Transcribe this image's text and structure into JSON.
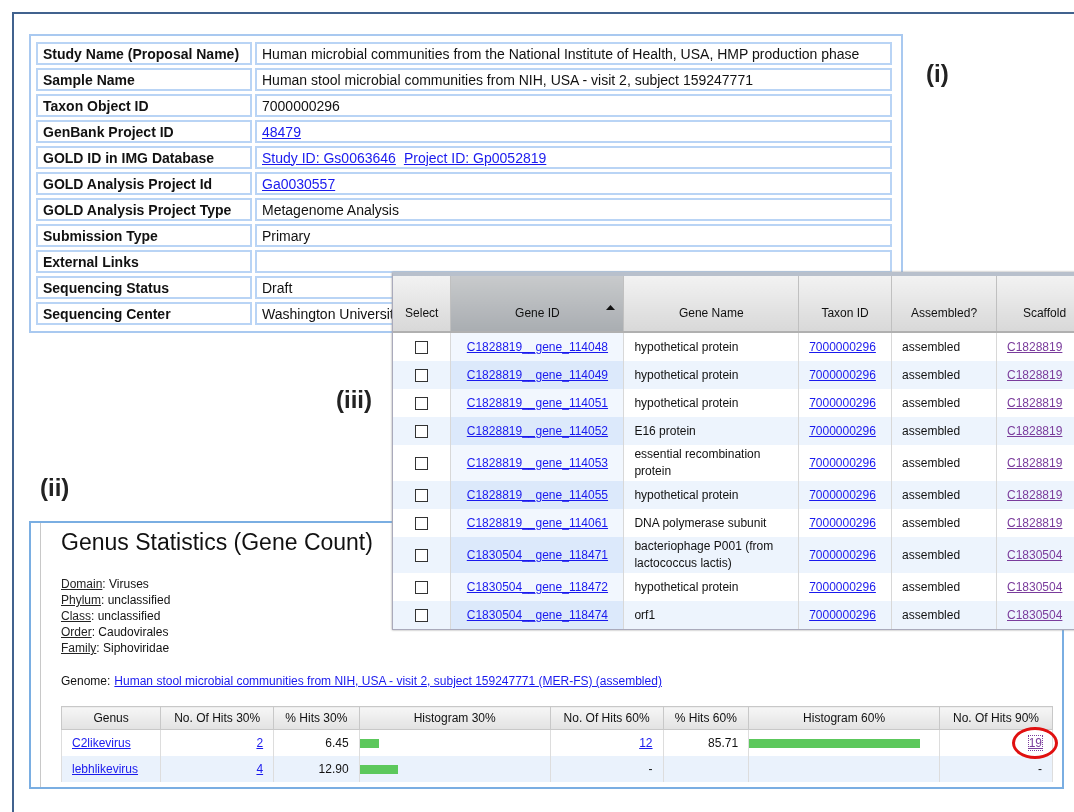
{
  "panel_labels": [
    {
      "text": "(i)",
      "kind": "i"
    },
    {
      "text": "(iii)",
      "kind": "iii"
    },
    {
      "text": "(ii)",
      "kind": "ii"
    }
  ],
  "project_info": {
    "rows": [
      {
        "label": "Study Name (Proposal Name)",
        "values": [
          {
            "text": "Human microbial communities from the National Institute of Health, USA, HMP production phase",
            "link": false
          }
        ]
      },
      {
        "label": "Sample Name",
        "values": [
          {
            "text": "Human stool microbial communities from NIH, USA - visit 2, subject 159247771",
            "link": false
          }
        ]
      },
      {
        "label": "Taxon Object ID",
        "values": [
          {
            "text": "7000000296",
            "link": false
          }
        ]
      },
      {
        "label": "GenBank Project ID",
        "values": [
          {
            "text": "48479",
            "link": true
          }
        ]
      },
      {
        "label": "GOLD ID in IMG Database",
        "values": [
          {
            "text": "Study ID: Gs0063646",
            "link": true
          },
          {
            "text": "Project ID: Gp0052819",
            "link": true
          }
        ]
      },
      {
        "label": "GOLD Analysis Project Id",
        "values": [
          {
            "text": "Ga0030557",
            "link": true
          }
        ]
      },
      {
        "label": "GOLD Analysis Project Type",
        "values": [
          {
            "text": "Metagenome Analysis",
            "link": false
          }
        ]
      },
      {
        "label": "Submission Type",
        "values": [
          {
            "text": "Primary",
            "link": false
          }
        ]
      },
      {
        "label": "External Links"
      },
      {
        "label": "Sequencing Status",
        "values": [
          {
            "text": "Draft",
            "link": false
          }
        ]
      },
      {
        "label": "Sequencing Center",
        "values": [
          {
            "text": "Washington Universit",
            "link": false
          }
        ]
      }
    ]
  },
  "gene_table": {
    "columns": [
      {
        "label": "Select",
        "sorted": false
      },
      {
        "label": "Gene ID",
        "sorted": true
      },
      {
        "label": "Gene Name",
        "sorted": false
      },
      {
        "label": "Taxon ID",
        "sorted": false
      },
      {
        "label": "Assembled?",
        "sorted": false
      },
      {
        "label": "Scaffold",
        "sorted": false
      }
    ],
    "rows": [
      {
        "selected": false,
        "gene_id": "C1828819__gene_114048",
        "gene_name": "hypothetical protein",
        "taxon_id": "7000000296",
        "assembled": "assembled",
        "scaffold": "C1828819"
      },
      {
        "selected": false,
        "gene_id": "C1828819__gene_114049",
        "gene_name": "hypothetical protein",
        "taxon_id": "7000000296",
        "assembled": "assembled",
        "scaffold": "C1828819"
      },
      {
        "selected": false,
        "gene_id": "C1828819__gene_114051",
        "gene_name": "hypothetical protein",
        "taxon_id": "7000000296",
        "assembled": "assembled",
        "scaffold": "C1828819"
      },
      {
        "selected": false,
        "gene_id": "C1828819__gene_114052",
        "gene_name": "E16 protein",
        "taxon_id": "7000000296",
        "assembled": "assembled",
        "scaffold": "C1828819"
      },
      {
        "selected": false,
        "gene_id": "C1828819__gene_114053",
        "gene_name": "essential recombination protein",
        "taxon_id": "7000000296",
        "assembled": "assembled",
        "scaffold": "C1828819"
      },
      {
        "selected": false,
        "gene_id": "C1828819__gene_114055",
        "gene_name": "hypothetical protein",
        "taxon_id": "7000000296",
        "assembled": "assembled",
        "scaffold": "C1828819"
      },
      {
        "selected": false,
        "gene_id": "C1828819__gene_114061",
        "gene_name": "DNA polymerase subunit",
        "taxon_id": "7000000296",
        "assembled": "assembled",
        "scaffold": "C1828819"
      },
      {
        "selected": false,
        "gene_id": "C1830504__gene_118471",
        "gene_name": "bacteriophage P001 (from lactococcus lactis)",
        "taxon_id": "7000000296",
        "assembled": "assembled",
        "scaffold": "C1830504"
      },
      {
        "selected": false,
        "gene_id": "C1830504__gene_118472",
        "gene_name": "hypothetical protein",
        "taxon_id": "7000000296",
        "assembled": "assembled",
        "scaffold": "C1830504"
      },
      {
        "selected": false,
        "gene_id": "C1830504__gene_118474",
        "gene_name": "orf1",
        "taxon_id": "7000000296",
        "assembled": "assembled",
        "scaffold": "C1830504"
      }
    ]
  },
  "genus_statistics": {
    "title": "Genus Statistics (Gene Count)",
    "taxonomy": [
      {
        "label": "Domain",
        "value": ": Viruses"
      },
      {
        "label": "Phylum",
        "value": ": unclassified"
      },
      {
        "label": "Class",
        "value": ": unclassified"
      },
      {
        "label": "Order",
        "value": ": Caudovirales"
      },
      {
        "label": "Family",
        "value": ": Siphoviridae"
      }
    ],
    "genome": {
      "label": "Genome:",
      "link": "Human stool microbial communities from NIH, USA - visit 2, subject 159247771 (MER-FS) (assembled)"
    },
    "table": {
      "columns": [
        "Genus",
        "No. Of Hits 30%",
        "% Hits 30%",
        "Histogram 30%",
        "No. Of Hits 60%",
        "% Hits 60%",
        "Histogram 60%",
        "No. Of Hits 90%"
      ],
      "rows": [
        {
          "genus": "C2likevirus",
          "hits_30": {
            "text": "2",
            "link": true
          },
          "pct_30": "6.45",
          "hist_30": {
            "level": 0.1
          },
          "hits_60": {
            "text": "12",
            "link": true
          },
          "pct_60": "85.71",
          "hist_60": {
            "level": 0.9
          },
          "hits_90": {
            "text": "19",
            "link": true,
            "highlighted": true
          }
        },
        {
          "genus": "lebhlikevirus",
          "hits_30": {
            "text": "4",
            "link": true
          },
          "pct_30": "12.90",
          "hist_30": {
            "level": 0.2
          },
          "hits_60": {
            "text": "-",
            "link": false
          },
          "hits_90": {
            "text": "-",
            "link": false,
            "highlighted": false
          }
        }
      ]
    }
  }
}
